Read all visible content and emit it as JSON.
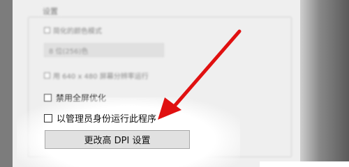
{
  "dialog": {
    "group_title": "设置",
    "options": [
      {
        "label": "简化的颜色模式",
        "checked": false
      },
      {
        "label": "8 位(256)色",
        "checked": false
      },
      {
        "label": "用 640 x 480 屏幕分辨率运行",
        "checked": false
      },
      {
        "label": "禁用全屏优化",
        "checked": false
      },
      {
        "label": "以管理员身份运行此程序",
        "checked": false
      }
    ],
    "color_select_value": "8 位(256)色",
    "dpi_button_label": "更改高 DPI 设置"
  },
  "annotation": {
    "arrow_color": "#e01010"
  }
}
